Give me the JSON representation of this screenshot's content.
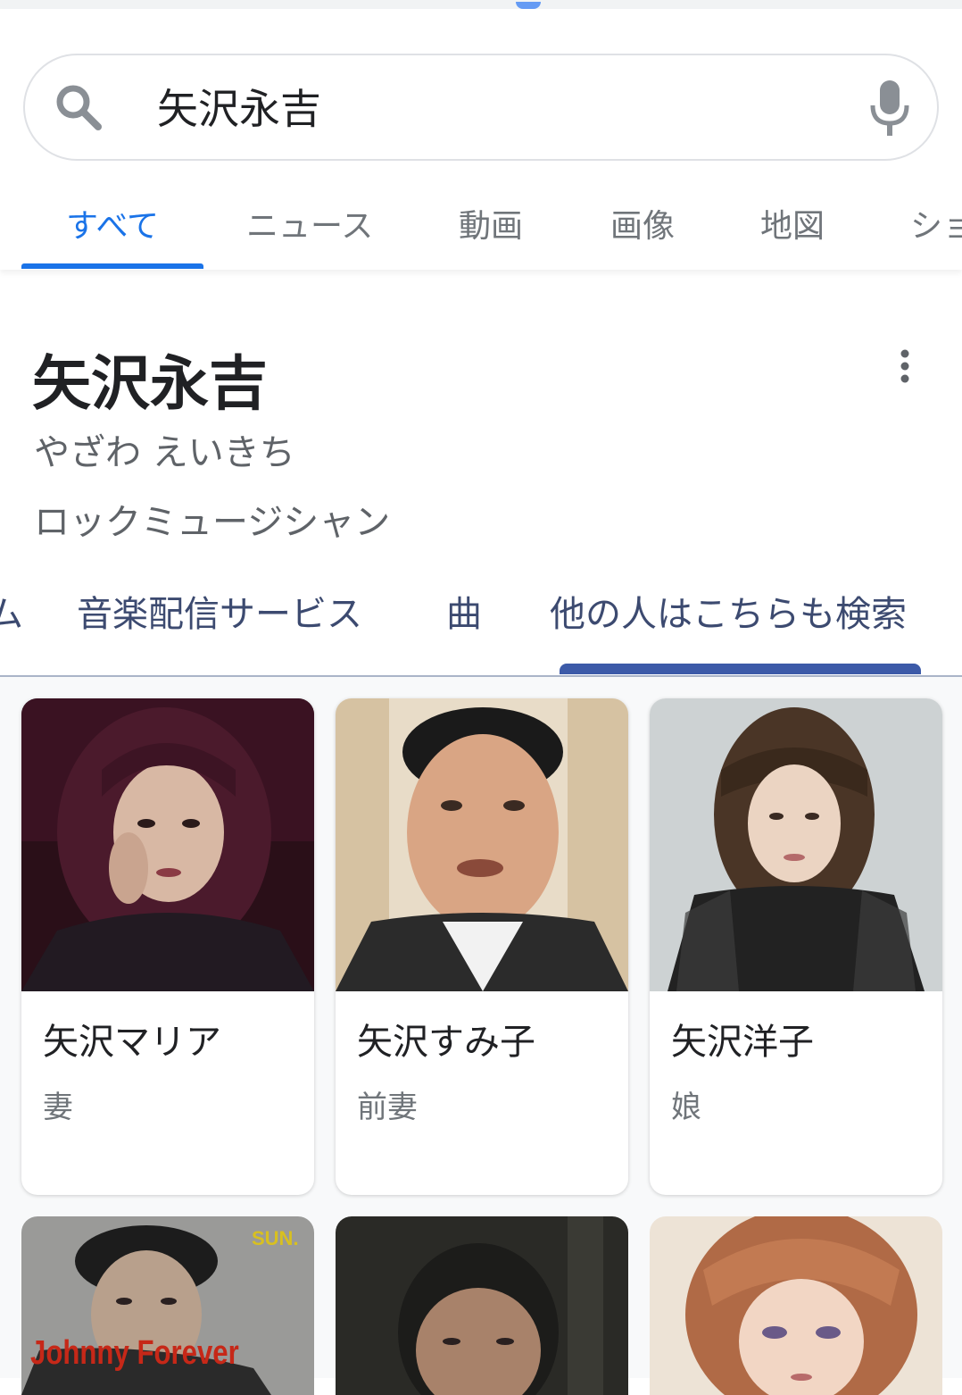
{
  "search": {
    "query": "矢沢永吉",
    "icons": {
      "search": "search-icon",
      "mic": "mic-icon"
    }
  },
  "tabs": [
    {
      "label": "すべて",
      "active": true
    },
    {
      "label": "ニュース"
    },
    {
      "label": "動画"
    },
    {
      "label": "画像"
    },
    {
      "label": "地図"
    },
    {
      "label": "ショ"
    }
  ],
  "knowledge_panel": {
    "title": "矢沢永吉",
    "reading": "やざわ えいきち",
    "type": "ロックミュージシャン",
    "more_icon": "more-vert-icon",
    "tabs": [
      {
        "label": "ム"
      },
      {
        "label": "音楽配信サービス"
      },
      {
        "label": "曲"
      },
      {
        "label": "他の人はこちらも検索",
        "active": true
      }
    ]
  },
  "related_people": [
    {
      "name": "矢沢マリア",
      "relation": "妻"
    },
    {
      "name": "矢沢すみ子",
      "relation": "前妻"
    },
    {
      "name": "矢沢洋子",
      "relation": "娘"
    }
  ],
  "second_row_images": {
    "album_text_top": "SUN.",
    "album_text": "Johnny Forever"
  },
  "colors": {
    "accent": "#1a73e8",
    "tab_inactive": "#70757a",
    "kp_tab_text": "#3c4a70",
    "kp_tab_indicator": "#3c5aa8"
  }
}
